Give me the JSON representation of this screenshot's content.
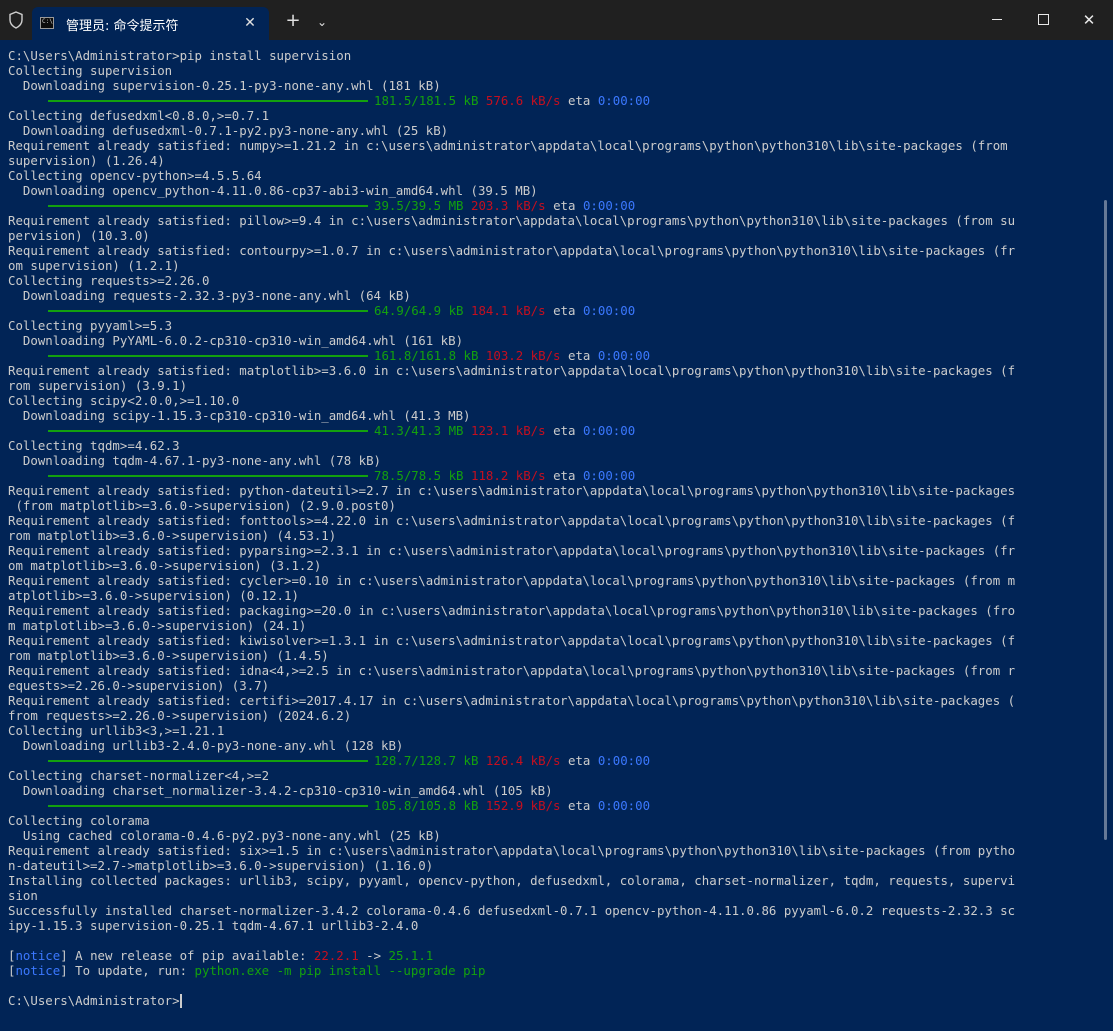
{
  "window": {
    "tab_title": "管理员: 命令提示符",
    "tab_icon_text": "C:\\",
    "icons": [
      "shield-icon",
      "terminal-icon",
      "close-icon",
      "plus-icon",
      "chevron-down-icon",
      "minimize-icon",
      "maximize-icon",
      "close-window-icon"
    ],
    "buttons": {
      "tab_close": "✕",
      "new_tab": "+",
      "tab_menu": "⌄",
      "close": "✕"
    }
  },
  "colors": {
    "background": "#012456",
    "titlebar": "#202020",
    "text": "#cccccc",
    "green": "#13a10e",
    "red": "#c50f1f",
    "blue": "#3b78ff"
  },
  "console": {
    "lines": [
      "C:\\Users\\Administrator>pip install supervision",
      "Collecting supervision",
      "  Downloading supervision-0.25.1-py3-none-any.whl (181 kB)",
      {
        "progress": "181.5/181.5 kB",
        "speed": "576.6 kB/s",
        "eta_label": "eta",
        "eta": "0:00:00"
      },
      "Collecting defusedxml<0.8.0,>=0.7.1",
      "  Downloading defusedxml-0.7.1-py2.py3-none-any.whl (25 kB)",
      "Requirement already satisfied: numpy>=1.21.2 in c:\\users\\administrator\\appdata\\local\\programs\\python\\python310\\lib\\site-packages (from",
      "supervision) (1.26.4)",
      "Collecting opencv-python>=4.5.5.64",
      "  Downloading opencv_python-4.11.0.86-cp37-abi3-win_amd64.whl (39.5 MB)",
      {
        "progress": "39.5/39.5 MB",
        "speed": "203.3 kB/s",
        "eta_label": "eta",
        "eta": "0:00:00"
      },
      "Requirement already satisfied: pillow>=9.4 in c:\\users\\administrator\\appdata\\local\\programs\\python\\python310\\lib\\site-packages (from su",
      "pervision) (10.3.0)",
      "Requirement already satisfied: contourpy>=1.0.7 in c:\\users\\administrator\\appdata\\local\\programs\\python\\python310\\lib\\site-packages (fr",
      "om supervision) (1.2.1)",
      "Collecting requests>=2.26.0",
      "  Downloading requests-2.32.3-py3-none-any.whl (64 kB)",
      {
        "progress": "64.9/64.9 kB",
        "speed": "184.1 kB/s",
        "eta_label": "eta",
        "eta": "0:00:00"
      },
      "Collecting pyyaml>=5.3",
      "  Downloading PyYAML-6.0.2-cp310-cp310-win_amd64.whl (161 kB)",
      {
        "progress": "161.8/161.8 kB",
        "speed": "103.2 kB/s",
        "eta_label": "eta",
        "eta": "0:00:00"
      },
      "Requirement already satisfied: matplotlib>=3.6.0 in c:\\users\\administrator\\appdata\\local\\programs\\python\\python310\\lib\\site-packages (f",
      "rom supervision) (3.9.1)",
      "Collecting scipy<2.0.0,>=1.10.0",
      "  Downloading scipy-1.15.3-cp310-cp310-win_amd64.whl (41.3 MB)",
      {
        "progress": "41.3/41.3 MB",
        "speed": "123.1 kB/s",
        "eta_label": "eta",
        "eta": "0:00:00"
      },
      "Collecting tqdm>=4.62.3",
      "  Downloading tqdm-4.67.1-py3-none-any.whl (78 kB)",
      {
        "progress": "78.5/78.5 kB",
        "speed": "118.2 kB/s",
        "eta_label": "eta",
        "eta": "0:00:00"
      },
      "Requirement already satisfied: python-dateutil>=2.7 in c:\\users\\administrator\\appdata\\local\\programs\\python\\python310\\lib\\site-packages",
      " (from matplotlib>=3.6.0->supervision) (2.9.0.post0)",
      "Requirement already satisfied: fonttools>=4.22.0 in c:\\users\\administrator\\appdata\\local\\programs\\python\\python310\\lib\\site-packages (f",
      "rom matplotlib>=3.6.0->supervision) (4.53.1)",
      "Requirement already satisfied: pyparsing>=2.3.1 in c:\\users\\administrator\\appdata\\local\\programs\\python\\python310\\lib\\site-packages (fr",
      "om matplotlib>=3.6.0->supervision) (3.1.2)",
      "Requirement already satisfied: cycler>=0.10 in c:\\users\\administrator\\appdata\\local\\programs\\python\\python310\\lib\\site-packages (from m",
      "atplotlib>=3.6.0->supervision) (0.12.1)",
      "Requirement already satisfied: packaging>=20.0 in c:\\users\\administrator\\appdata\\local\\programs\\python\\python310\\lib\\site-packages (fro",
      "m matplotlib>=3.6.0->supervision) (24.1)",
      "Requirement already satisfied: kiwisolver>=1.3.1 in c:\\users\\administrator\\appdata\\local\\programs\\python\\python310\\lib\\site-packages (f",
      "rom matplotlib>=3.6.0->supervision) (1.4.5)",
      "Requirement already satisfied: idna<4,>=2.5 in c:\\users\\administrator\\appdata\\local\\programs\\python\\python310\\lib\\site-packages (from r",
      "equests>=2.26.0->supervision) (3.7)",
      "Requirement already satisfied: certifi>=2017.4.17 in c:\\users\\administrator\\appdata\\local\\programs\\python\\python310\\lib\\site-packages (",
      "from requests>=2.26.0->supervision) (2024.6.2)",
      "Collecting urllib3<3,>=1.21.1",
      "  Downloading urllib3-2.4.0-py3-none-any.whl (128 kB)",
      {
        "progress": "128.7/128.7 kB",
        "speed": "126.4 kB/s",
        "eta_label": "eta",
        "eta": "0:00:00"
      },
      "Collecting charset-normalizer<4,>=2",
      "  Downloading charset_normalizer-3.4.2-cp310-cp310-win_amd64.whl (105 kB)",
      {
        "progress": "105.8/105.8 kB",
        "speed": "152.9 kB/s",
        "eta_label": "eta",
        "eta": "0:00:00"
      },
      "Collecting colorama",
      "  Using cached colorama-0.4.6-py2.py3-none-any.whl (25 kB)",
      "Requirement already satisfied: six>=1.5 in c:\\users\\administrator\\appdata\\local\\programs\\python\\python310\\lib\\site-packages (from pytho",
      "n-dateutil>=2.7->matplotlib>=3.6.0->supervision) (1.16.0)",
      "Installing collected packages: urllib3, scipy, pyyaml, opencv-python, defusedxml, colorama, charset-normalizer, tqdm, requests, supervi",
      "sion",
      "Successfully installed charset-normalizer-3.4.2 colorama-0.4.6 defusedxml-0.7.1 opencv-python-4.11.0.86 pyyaml-6.0.2 requests-2.32.3 sc",
      "ipy-1.15.3 supervision-0.25.1 tqdm-4.67.1 urllib3-2.4.0",
      "",
      {
        "notice": "notice",
        "text": " A new release of pip available: ",
        "old": "22.2.1",
        "arrow": " -> ",
        "new": "25.1.1"
      },
      {
        "notice": "notice",
        "text": " To update, run: ",
        "cmd": "python.exe -m pip install --upgrade pip"
      },
      "",
      {
        "prompt": "C:\\Users\\Administrator>",
        "cursor": true
      }
    ]
  }
}
